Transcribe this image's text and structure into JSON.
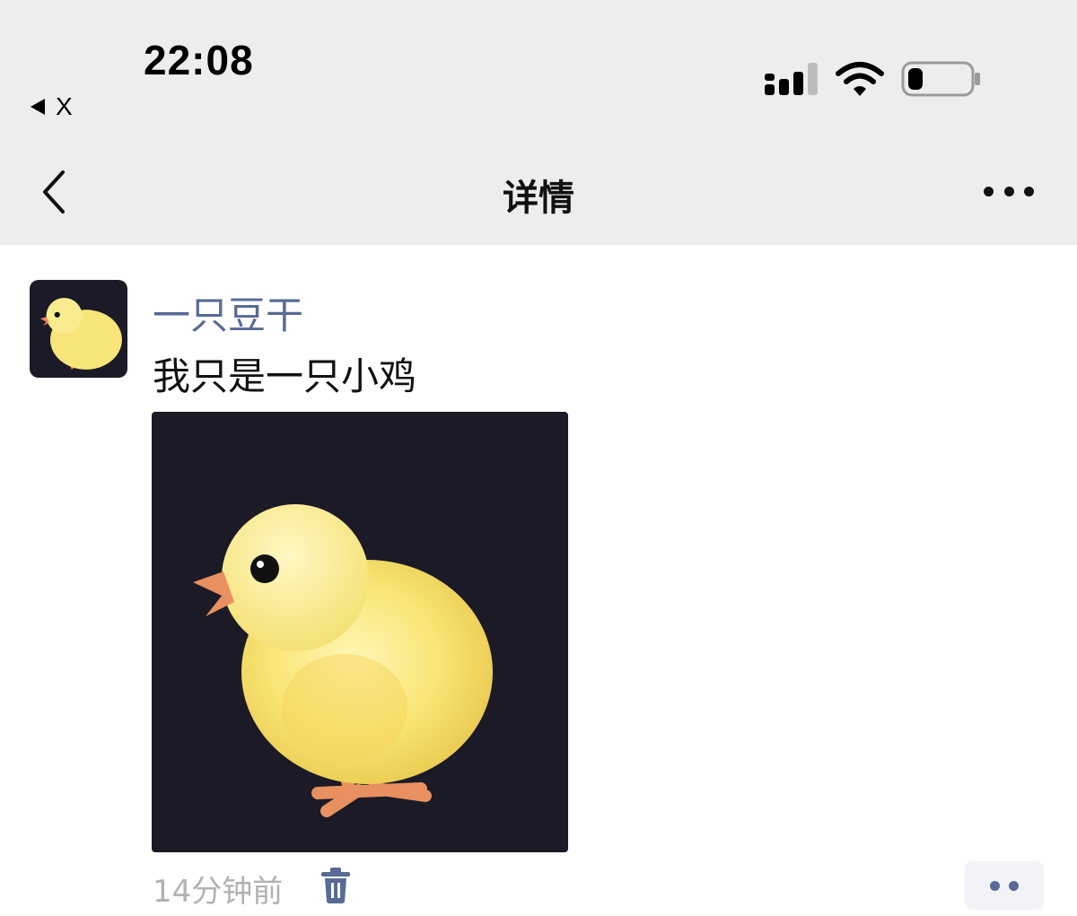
{
  "status_bar": {
    "time": "22:08",
    "back_app_label": "X"
  },
  "nav": {
    "title": "详情"
  },
  "post": {
    "username": "一只豆干",
    "text": "我只是一只小鸡",
    "timestamp": "14分钟前"
  },
  "colors": {
    "header_bg": "#ededed",
    "username": "#576b95",
    "timestamp": "#b2b2b2",
    "image_bg": "#1b1a26",
    "chick_yellow": "#f7e57a"
  },
  "icons": [
    "back-arrow-icon",
    "signal-icon",
    "wifi-icon",
    "battery-icon",
    "chevron-left-icon",
    "more-icon",
    "trash-icon"
  ]
}
